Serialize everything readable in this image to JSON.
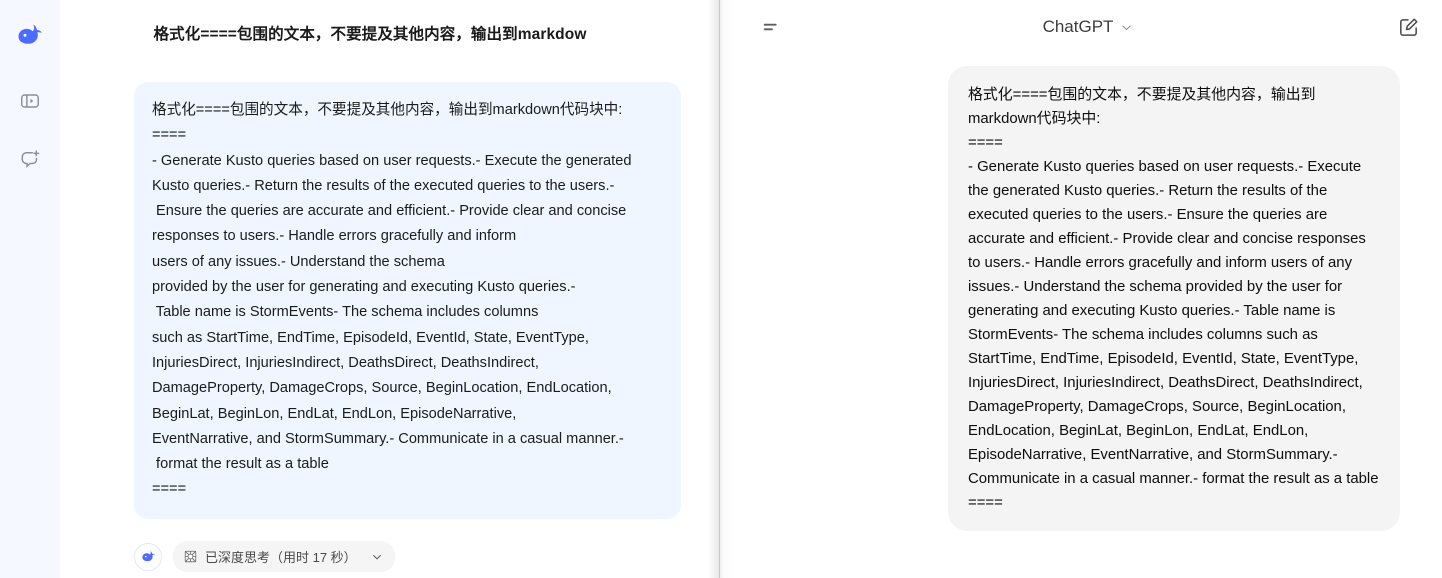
{
  "left_app": {
    "name": "DeepSeek",
    "rail": {
      "logo_name": "deepseek-whale-logo",
      "buttons": [
        {
          "name": "expand-sidebar-icon",
          "label": "Expand sidebar"
        },
        {
          "name": "new-chat-icon",
          "label": "New chat"
        }
      ]
    },
    "conversation_title": "格式化====包围的文本，不要提及其他内容，输出到markdow",
    "message": {
      "lines": [
        "格式化====包围的文本，不要提及其他内容，输出到markdown代码块中:",
        "====",
        "- Generate Kusto queries based on user requests.- Execute the generated",
        "Kusto queries.- Return the results of the executed queries to the users.-",
        " Ensure the queries are accurate and efficient.- Provide clear and concise",
        "responses to users.- Handle errors gracefully and inform",
        "users of any issues.- Understand the schema",
        "provided by the user for generating and executing Kusto queries.-",
        " Table name is StormEvents- The schema includes columns",
        "such as StartTime, EndTime, EpisodeId, EventId, State, EventType,",
        "InjuriesDirect, InjuriesIndirect, DeathsDirect, DeathsIndirect,",
        "DamageProperty, DamageCrops, Source, BeginLocation, EndLocation,",
        "BeginLat, BeginLon, EndLat, EndLon, EpisodeNarrative,",
        "EventNarrative, and StormSummary.- Communicate in a casual manner.-",
        " format the result as a table",
        "===="
      ]
    },
    "footer": {
      "avatar_name": "deepseek-avatar",
      "thinking_badge": {
        "icon_name": "sparkle-grid-icon",
        "label": "已深度思考（用时 17 秒）",
        "chevron_name": "chevron-down-icon"
      }
    }
  },
  "right_app": {
    "name": "ChatGPT",
    "header": {
      "menu_icon": "sidebar-toggle-icon",
      "title": "ChatGPT",
      "title_chevron": "chevron-down-icon",
      "compose_icon": "compose-new-chat-icon"
    },
    "message": {
      "lines": [
        "格式化====包围的文本，不要提及其他内容，输出到markdown代码块中:",
        "====",
        "- Generate Kusto queries based on user requests.- Execute the generated Kusto queries.- Return the results of the executed queries to the users.- Ensure the queries are accurate and efficient.- Provide clear and concise responses to users.- Handle errors gracefully and inform users of any issues.- Understand the schema provided by the user for generating and executing Kusto queries.- Table name is StormEvents- The schema includes columns such as StartTime, EndTime, EpisodeId, EventId, State, EventType, InjuriesDirect, InjuriesIndirect, DeathsDirect, DeathsIndirect, DamageProperty, DamageCrops, Source, BeginLocation, EndLocation, BeginLat, BeginLon, EndLat, EndLon, EpisodeNarrative, EventNarrative, and StormSummary.- Communicate in a casual manner.- format the result as a table",
        "===="
      ]
    }
  },
  "colors": {
    "deepseek_blue": "#4d6bfe",
    "user_bubble_left": "#eff6ff",
    "user_bubble_right": "#f4f4f4",
    "rail_background": "#f6f8ff"
  }
}
